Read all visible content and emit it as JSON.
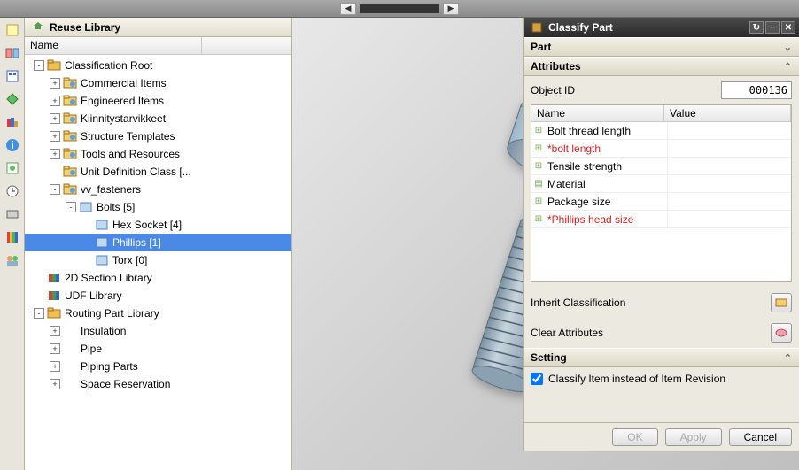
{
  "reuse": {
    "title": "Reuse Library",
    "column": "Name",
    "nodes": [
      {
        "indent": 0,
        "exp": "-",
        "icon": "root",
        "label": "Classification Root"
      },
      {
        "indent": 1,
        "exp": "+",
        "icon": "folder",
        "label": "Commercial Items"
      },
      {
        "indent": 1,
        "exp": "+",
        "icon": "folder",
        "label": "Engineered Items"
      },
      {
        "indent": 1,
        "exp": "+",
        "icon": "folder",
        "label": "Kiinnitystarvikkeet"
      },
      {
        "indent": 1,
        "exp": "+",
        "icon": "folder",
        "label": "Structure Templates"
      },
      {
        "indent": 1,
        "exp": "+",
        "icon": "folder",
        "label": "Tools and Resources"
      },
      {
        "indent": 1,
        "exp": " ",
        "icon": "folder",
        "label": "Unit Definition Class [..."
      },
      {
        "indent": 1,
        "exp": "-",
        "icon": "folder",
        "label": "vv_fasteners"
      },
      {
        "indent": 2,
        "exp": "-",
        "icon": "leaf",
        "label": "Bolts [5]"
      },
      {
        "indent": 3,
        "exp": " ",
        "icon": "leaf",
        "label": "Hex Socket [4]"
      },
      {
        "indent": 3,
        "exp": " ",
        "icon": "leaf",
        "label": "Phillips [1]",
        "selected": true
      },
      {
        "indent": 3,
        "exp": " ",
        "icon": "leaf",
        "label": "Torx [0]"
      },
      {
        "indent": 0,
        "exp": " ",
        "icon": "lib",
        "label": "2D Section Library"
      },
      {
        "indent": 0,
        "exp": " ",
        "icon": "lib",
        "label": "UDF Library"
      },
      {
        "indent": 0,
        "exp": "-",
        "icon": "root",
        "label": "Routing Part Library"
      },
      {
        "indent": 1,
        "exp": "+",
        "icon": "plain",
        "label": "Insulation"
      },
      {
        "indent": 1,
        "exp": "+",
        "icon": "plain",
        "label": "Pipe"
      },
      {
        "indent": 1,
        "exp": "+",
        "icon": "plain",
        "label": "Piping Parts"
      },
      {
        "indent": 1,
        "exp": "+",
        "icon": "plain",
        "label": "Space Reservation"
      }
    ]
  },
  "classify": {
    "title": "Classify Part",
    "sections": {
      "part": "Part",
      "attributes": "Attributes",
      "setting": "Setting"
    },
    "object_id_label": "Object ID",
    "object_id_value": "000136",
    "attr_columns": {
      "name": "Name",
      "value": "Value"
    },
    "attributes": [
      {
        "name": "Bolt thread length",
        "required": false
      },
      {
        "name": "*bolt length",
        "required": true
      },
      {
        "name": "Tensile strength",
        "required": false
      },
      {
        "name": "Material",
        "required": false,
        "icon": "doc"
      },
      {
        "name": "Package size",
        "required": false
      },
      {
        "name": "*Phillips head size",
        "required": true
      }
    ],
    "inherit_label": "Inherit Classification",
    "clear_label": "Clear Attributes",
    "checkbox_label": "Classify Item instead of Item Revision",
    "checkbox_checked": true,
    "buttons": {
      "ok": "OK",
      "apply": "Apply",
      "cancel": "Cancel"
    }
  }
}
